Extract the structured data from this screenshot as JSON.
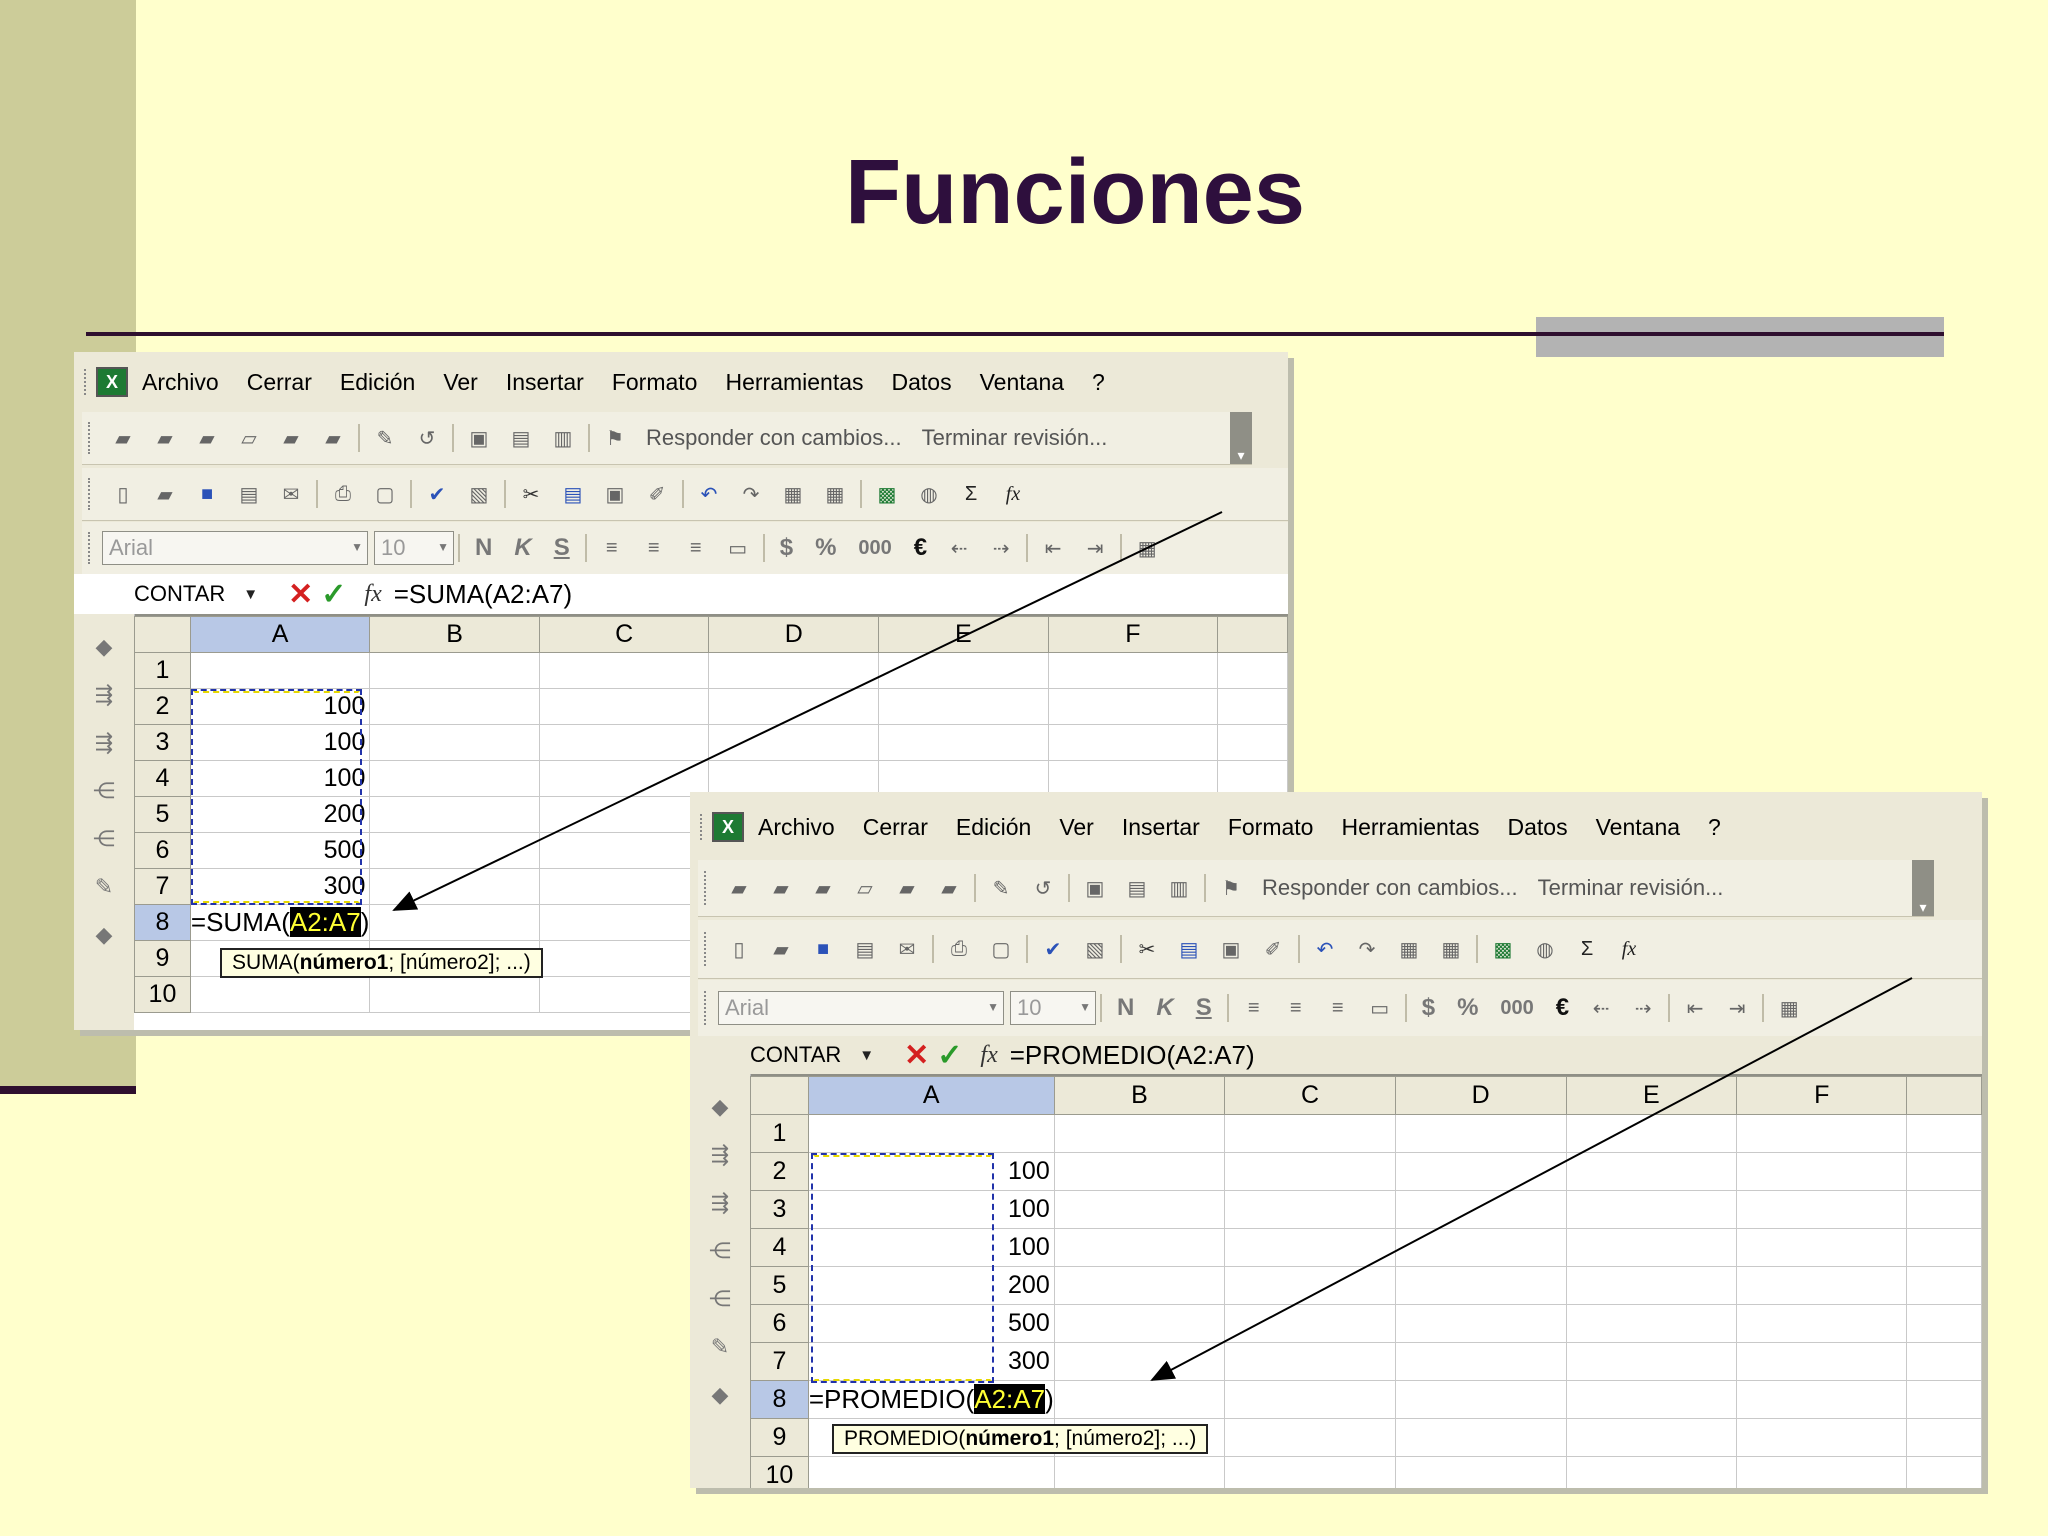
{
  "slide": {
    "title": "Funciones"
  },
  "menu": [
    "Archivo",
    "Cerrar",
    "Edición",
    "Ver",
    "Insertar",
    "Formato",
    "Herramientas",
    "Datos",
    "Ventana",
    "?"
  ],
  "review_toolbar": {
    "reply_label": "Responder con cambios...",
    "end_label": "Terminar revisión..."
  },
  "format_toolbar": {
    "font": "Arial",
    "size": "10",
    "bold": "N",
    "italic": "K",
    "underline": "S",
    "currency": "$",
    "percent": "%",
    "thousands": "000",
    "euro": "€"
  },
  "std_toolbar": {
    "sigma": "Σ",
    "fx": "fx"
  },
  "grid": {
    "columns": [
      "A",
      "B",
      "C",
      "D",
      "E",
      "F"
    ],
    "rows": [
      "1",
      "2",
      "3",
      "4",
      "5",
      "6",
      "7",
      "8",
      "9",
      "10"
    ],
    "values": [
      "100",
      "100",
      "100",
      "200",
      "500",
      "300"
    ]
  },
  "shot1": {
    "name_box": "CONTAR",
    "formula": "=SUMA(A2:A7)",
    "cell_prefix": "=SUMA(",
    "cell_ref": "A2:A7",
    "cell_suffix": ")",
    "tooltip_fn": "SUMA(",
    "tooltip_arg1": "número1",
    "tooltip_rest": "; [número2]; ...)"
  },
  "shot2": {
    "name_box": "CONTAR",
    "formula": "=PROMEDIO(A2:A7)",
    "cell_prefix": "=PROMEDIO(",
    "cell_ref": "A2:A7",
    "cell_suffix": ")",
    "tooltip_fn": "PROMEDIO(",
    "tooltip_arg1": "número1",
    "tooltip_rest": "; [número2]; ...)"
  },
  "colors": {
    "background": "#ffffcc",
    "sidebar": "#cccc99",
    "title": "#2e0f3d",
    "accent_line": "#2e0f2e"
  }
}
